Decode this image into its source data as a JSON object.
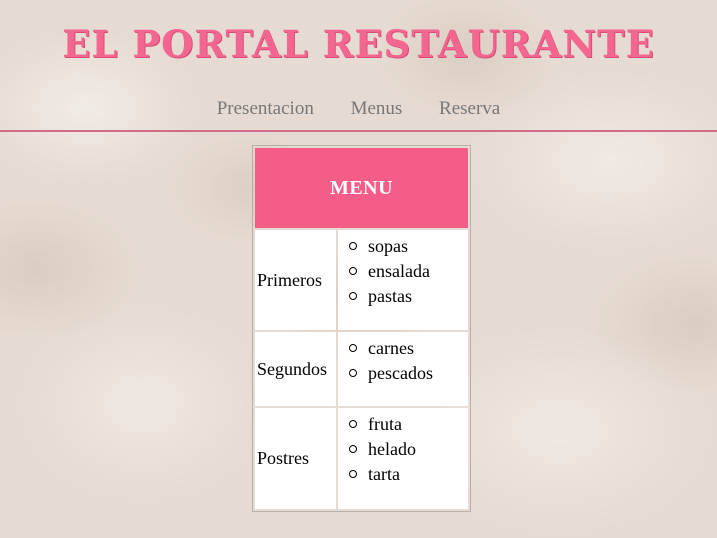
{
  "header": {
    "title": "EL PORTAL RESTAURANTE"
  },
  "nav": {
    "items": [
      "Presentacion",
      "Menus",
      "Reserva"
    ]
  },
  "menu": {
    "heading": "MENU",
    "sections": [
      {
        "name": "Primeros",
        "items": [
          "sopas",
          "ensalada",
          "pastas"
        ]
      },
      {
        "name": "Segundos",
        "items": [
          "carnes",
          "pescados"
        ]
      },
      {
        "name": "Postres",
        "items": [
          "fruta",
          "helado",
          "tarta"
        ]
      }
    ]
  },
  "colors": {
    "accent": "#f55d89",
    "title": "#f2668f",
    "nav_text": "#777777",
    "rule": "#d46a8a",
    "background": "#e6dbd2"
  }
}
